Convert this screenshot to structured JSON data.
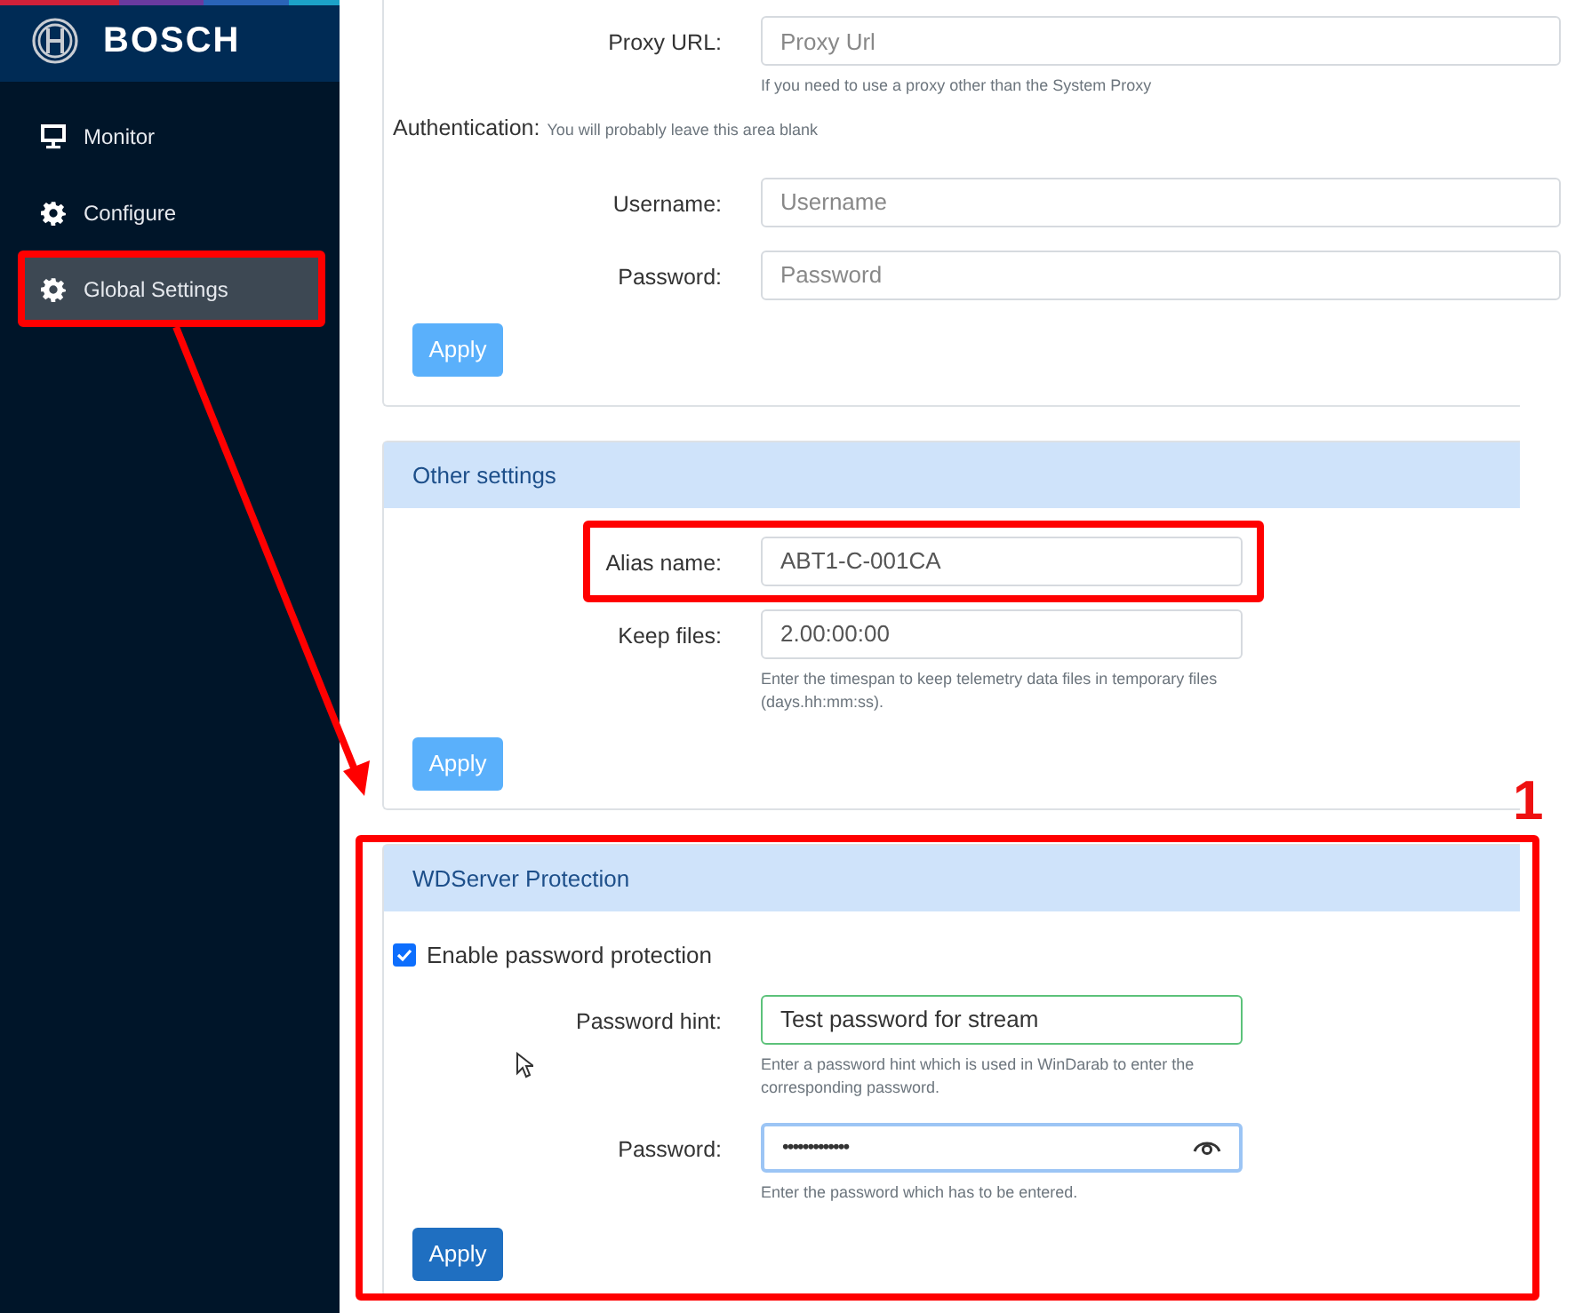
{
  "sidebar": {
    "brand": "BOSCH",
    "items": [
      {
        "label": "Monitor",
        "selected": false,
        "highlighted": false
      },
      {
        "label": "Configure",
        "selected": false,
        "highlighted": false
      },
      {
        "label": "Global Settings",
        "selected": true,
        "highlighted": true
      }
    ]
  },
  "sections": [
    {
      "highlighted": false,
      "items": [
        {
          "kind": "field",
          "label": "Proxy URL:",
          "placeholder": "Proxy Url",
          "help": "If you need to use a proxy other than the System Proxy",
          "wide": true,
          "highlighted": false,
          "valid": false,
          "focused": false
        },
        {
          "kind": "note",
          "label": "Authentication:",
          "help": "You will probably leave this area blank"
        },
        {
          "kind": "field",
          "label": "Username:",
          "placeholder": "Username",
          "wide": true,
          "highlighted": false,
          "valid": false,
          "focused": false
        },
        {
          "kind": "field",
          "label": "Password:",
          "placeholder": "Password",
          "wide": true,
          "highlighted": false,
          "valid": false,
          "focused": false
        }
      ],
      "button": {
        "label": "Apply",
        "disabled": true
      }
    },
    {
      "title": "Other settings",
      "highlighted": false,
      "items": [
        {
          "kind": "field",
          "label": "Alias name:",
          "value": "ABT1-C-001CA",
          "wide": false,
          "highlighted": true,
          "valid": false,
          "focused": false
        },
        {
          "kind": "field",
          "label": "Keep files:",
          "value": "2.00:00:00",
          "help": "Enter the timespan to keep telemetry data files in temporary files (days.hh:mm:ss).",
          "wide": false,
          "highlighted": false,
          "valid": false,
          "focused": false
        }
      ],
      "button": {
        "label": "Apply",
        "disabled": true
      }
    },
    {
      "title": "WDServer Protection",
      "highlighted": true,
      "items": [
        {
          "kind": "checkbox",
          "label": "Enable password protection",
          "checked": true
        },
        {
          "kind": "field",
          "label": "Password hint:",
          "value": "Test password for stream",
          "help": "Enter a password hint which is used in WinDarab to enter the corresponding password.",
          "wide": false,
          "highlighted": false,
          "valid": true,
          "focused": false
        },
        {
          "kind": "secret",
          "label": "Password:",
          "value": "•••••••••••••",
          "help": "Enter the password which has to be entered.",
          "wide": false,
          "highlighted": false,
          "valid": false,
          "focused": true
        }
      ],
      "button": {
        "label": "Apply",
        "disabled": false
      }
    }
  ],
  "annotation": {
    "label": "1"
  }
}
